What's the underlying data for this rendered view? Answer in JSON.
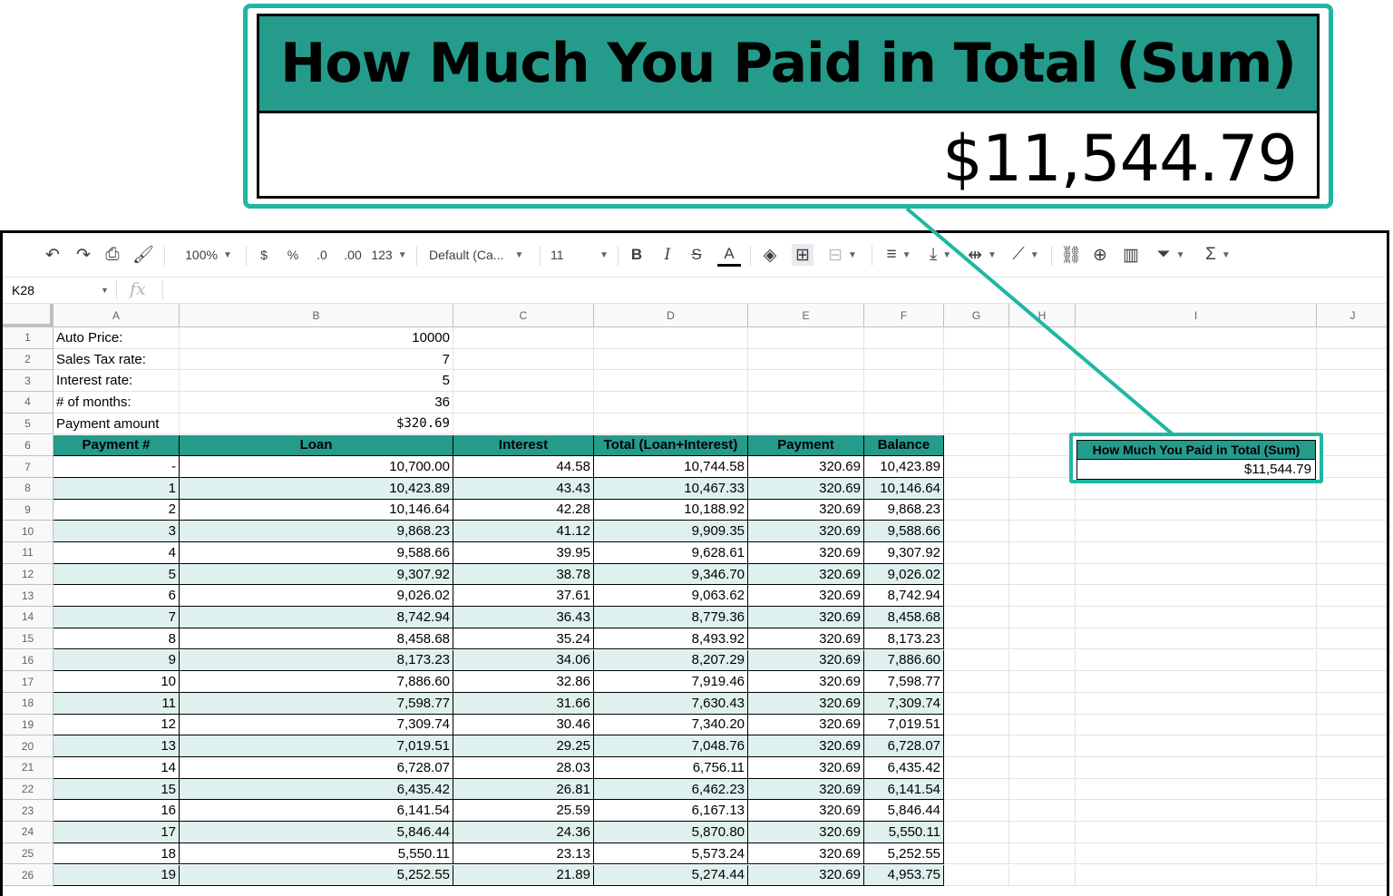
{
  "callout": {
    "title": "How Much You Paid in Total (Sum)",
    "value": "$11,544.79"
  },
  "toolbar": {
    "zoom": "100%",
    "currency": "$",
    "percent": "%",
    "decrease_decimal": ".0",
    "increase_decimal": ".00",
    "more_formats": "123",
    "font": "Default (Ca...",
    "font_size": "11",
    "bold": "B",
    "italic": "I",
    "strikethrough": "S",
    "text_color": "A"
  },
  "formula_bar": {
    "cell_ref": "K28",
    "fx": "fx"
  },
  "columns": [
    "A",
    "B",
    "C",
    "D",
    "E",
    "F",
    "G",
    "H",
    "I",
    "J"
  ],
  "inputs": [
    {
      "row": "1",
      "label": "Auto Price:",
      "value": "10000"
    },
    {
      "row": "2",
      "label": "Sales Tax rate:",
      "value": "7"
    },
    {
      "row": "3",
      "label": "Interest rate:",
      "value": "5"
    },
    {
      "row": "4",
      "label": "# of months:",
      "value": "36"
    },
    {
      "row": "5",
      "label": "Payment amount",
      "value": "$320.69"
    }
  ],
  "table": {
    "header_row": "6",
    "headers": [
      "Payment  #",
      "Loan",
      "Interest",
      "Total (Loan+Interest)",
      "Payment",
      "Balance"
    ],
    "rows": [
      {
        "row": "7",
        "cells": [
          "-",
          "10,700.00",
          "44.58",
          "10,744.58",
          "320.69",
          "10,423.89"
        ]
      },
      {
        "row": "8",
        "cells": [
          "1",
          "10,423.89",
          "43.43",
          "10,467.33",
          "320.69",
          "10,146.64"
        ]
      },
      {
        "row": "9",
        "cells": [
          "2",
          "10,146.64",
          "42.28",
          "10,188.92",
          "320.69",
          "9,868.23"
        ]
      },
      {
        "row": "10",
        "cells": [
          "3",
          "9,868.23",
          "41.12",
          "9,909.35",
          "320.69",
          "9,588.66"
        ]
      },
      {
        "row": "11",
        "cells": [
          "4",
          "9,588.66",
          "39.95",
          "9,628.61",
          "320.69",
          "9,307.92"
        ]
      },
      {
        "row": "12",
        "cells": [
          "5",
          "9,307.92",
          "38.78",
          "9,346.70",
          "320.69",
          "9,026.02"
        ]
      },
      {
        "row": "13",
        "cells": [
          "6",
          "9,026.02",
          "37.61",
          "9,063.62",
          "320.69",
          "8,742.94"
        ]
      },
      {
        "row": "14",
        "cells": [
          "7",
          "8,742.94",
          "36.43",
          "8,779.36",
          "320.69",
          "8,458.68"
        ]
      },
      {
        "row": "15",
        "cells": [
          "8",
          "8,458.68",
          "35.24",
          "8,493.92",
          "320.69",
          "8,173.23"
        ]
      },
      {
        "row": "16",
        "cells": [
          "9",
          "8,173.23",
          "34.06",
          "8,207.29",
          "320.69",
          "7,886.60"
        ]
      },
      {
        "row": "17",
        "cells": [
          "10",
          "7,886.60",
          "32.86",
          "7,919.46",
          "320.69",
          "7,598.77"
        ]
      },
      {
        "row": "18",
        "cells": [
          "11",
          "7,598.77",
          "31.66",
          "7,630.43",
          "320.69",
          "7,309.74"
        ]
      },
      {
        "row": "19",
        "cells": [
          "12",
          "7,309.74",
          "30.46",
          "7,340.20",
          "320.69",
          "7,019.51"
        ]
      },
      {
        "row": "20",
        "cells": [
          "13",
          "7,019.51",
          "29.25",
          "7,048.76",
          "320.69",
          "6,728.07"
        ]
      },
      {
        "row": "21",
        "cells": [
          "14",
          "6,728.07",
          "28.03",
          "6,756.11",
          "320.69",
          "6,435.42"
        ]
      },
      {
        "row": "22",
        "cells": [
          "15",
          "6,435.42",
          "26.81",
          "6,462.23",
          "320.69",
          "6,141.54"
        ]
      },
      {
        "row": "23",
        "cells": [
          "16",
          "6,141.54",
          "25.59",
          "6,167.13",
          "320.69",
          "5,846.44"
        ]
      },
      {
        "row": "24",
        "cells": [
          "17",
          "5,846.44",
          "24.36",
          "5,870.80",
          "320.69",
          "5,550.11"
        ]
      },
      {
        "row": "25",
        "cells": [
          "18",
          "5,550.11",
          "23.13",
          "5,573.24",
          "320.69",
          "5,252.55"
        ]
      },
      {
        "row": "26",
        "cells": [
          "19",
          "5,252.55",
          "21.89",
          "5,274.44",
          "320.69",
          "4,953.75"
        ]
      }
    ]
  },
  "summary": {
    "title": "How Much You Paid in Total (Sum)",
    "value": "$11,544.79"
  },
  "colors": {
    "header_teal": "#259b8b",
    "callout_border": "#1fb7a0",
    "band": "#dff1ee"
  }
}
